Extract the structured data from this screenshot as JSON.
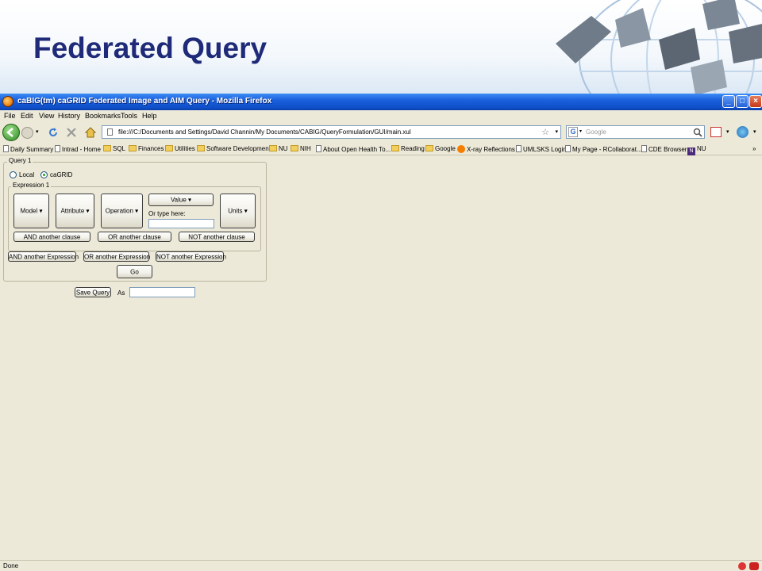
{
  "slide": {
    "title": "Federated Query"
  },
  "window": {
    "title": "caBIG(tm) caGRID Federated Image and AIM Query - Mozilla Firefox",
    "controls": {
      "minimize": "_",
      "maximize": "□",
      "close": "×"
    }
  },
  "menu": [
    "File",
    "Edit",
    "View",
    "History",
    "Bookmarks",
    "Tools",
    "Help"
  ],
  "nav": {
    "url": "file:///C:/Documents and Settings/David Channin/My Documents/CABIG/QueryFormulation/GUI/main.xul",
    "search_placeholder": "Google"
  },
  "bookmarks": [
    {
      "label": "Daily Summary",
      "icon": "page-icon"
    },
    {
      "label": "Intrad - Home",
      "icon": "page-icon"
    },
    {
      "label": "SQL",
      "icon": "folder-icon"
    },
    {
      "label": "Finances",
      "icon": "folder-icon"
    },
    {
      "label": "Utilities",
      "icon": "folder-icon"
    },
    {
      "label": "Software Development",
      "icon": "folder-icon"
    },
    {
      "label": "NU",
      "icon": "folder-icon"
    },
    {
      "label": "NIH",
      "icon": "folder-icon"
    },
    {
      "label": "About Open Health To...",
      "icon": "page-icon"
    },
    {
      "label": "Reading",
      "icon": "folder-icon"
    },
    {
      "label": "Google",
      "icon": "folder-icon"
    },
    {
      "label": "X-ray Reflections",
      "icon": "blogger-icon"
    },
    {
      "label": "UMLSKS Login",
      "icon": "page-icon"
    },
    {
      "label": "My Page - RCollaborat...",
      "icon": "page-icon"
    },
    {
      "label": "CDE Browser",
      "icon": "page-icon"
    },
    {
      "label": "NU",
      "icon": "n-icon"
    }
  ],
  "query": {
    "legend": "Query 1",
    "source_options": [
      "Local",
      "caGRID"
    ],
    "selected_source": "caGRID",
    "expression": {
      "legend": "Expression 1",
      "model_label": "Model",
      "attribute_label": "Attribute",
      "operation_label": "Operation",
      "value_label": "Value",
      "or_type_label": "Or type here:",
      "or_type_value": "",
      "units_label": "Units",
      "and_clause": "AND another clause",
      "or_clause": "OR another clause",
      "not_clause": "NOT another clause"
    },
    "and_expression": "AND another Expression",
    "or_expression": "OR another Expression",
    "not_expression": "NOT another Expression",
    "go_label": "Go"
  },
  "save": {
    "button_label": "Save Query",
    "as_label": "As",
    "as_value": ""
  },
  "status": {
    "text": "Done"
  },
  "colors": {
    "titlebar": "#1a5fdc",
    "slide_title": "#1f2a78",
    "window_bg": "#ece9d8"
  }
}
